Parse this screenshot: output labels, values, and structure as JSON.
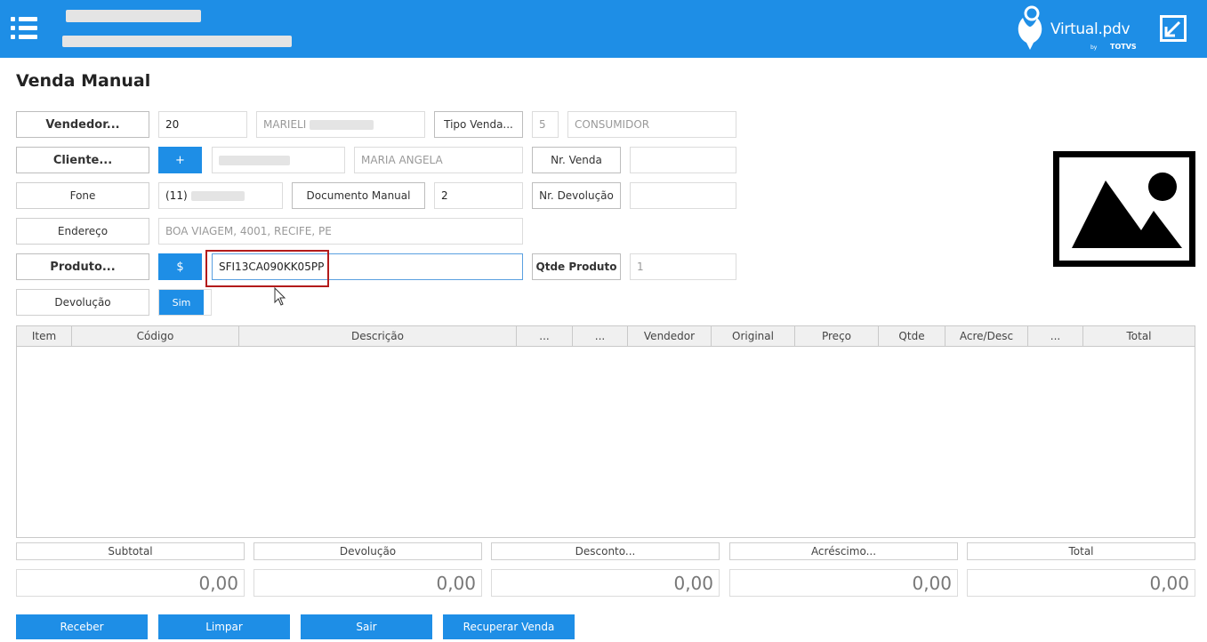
{
  "header": {
    "brand": "Virtual.pdv",
    "brand_by": "by",
    "brand_company": "TOTVS",
    "accent_color": "#1e8ee6"
  },
  "page": {
    "title": "Venda Manual"
  },
  "form": {
    "vendedor": {
      "label": "Vendedor...",
      "code": "20",
      "name": "MARIELI"
    },
    "tipo_venda": {
      "label": "Tipo Venda...",
      "code": "5",
      "name": "CONSUMIDOR"
    },
    "cliente": {
      "label": "Cliente...",
      "add_label": "+",
      "name": "MARIA ANGELA"
    },
    "nr_venda": {
      "label": "Nr. Venda",
      "value": ""
    },
    "fone": {
      "label": "Fone",
      "value": "(11)"
    },
    "documento_manual": {
      "label": "Documento Manual",
      "value": "2"
    },
    "nr_devolucao": {
      "label": "Nr. Devolução",
      "value": ""
    },
    "endereco": {
      "label": "Endereço",
      "value": "BOA VIAGEM, 4001, RECIFE, PE"
    },
    "produto": {
      "label": "Produto...",
      "price_label": "$",
      "value": "SFI13CA090KK05PP"
    },
    "qtde_produto": {
      "label": "Qtde Produto",
      "value": "1"
    },
    "devolucao": {
      "label": "Devolução",
      "toggle_label": "Sim"
    }
  },
  "grid": {
    "columns": [
      "Item",
      "Código",
      "Descrição",
      "...",
      "...",
      "Vendedor",
      "Original",
      "Preço",
      "Qtde",
      "Acre/Desc",
      "...",
      "Total"
    ],
    "rows": []
  },
  "totals": [
    {
      "label": "Subtotal",
      "value": "0,00"
    },
    {
      "label": "Devolução",
      "value": "0,00"
    },
    {
      "label": "Desconto...",
      "value": "0,00"
    },
    {
      "label": "Acréscimo...",
      "value": "0,00"
    },
    {
      "label": "Total",
      "value": "0,00"
    }
  ],
  "actions": {
    "receber": "Receber",
    "limpar": "Limpar",
    "sair": "Sair",
    "recuperar": "Recuperar Venda"
  }
}
